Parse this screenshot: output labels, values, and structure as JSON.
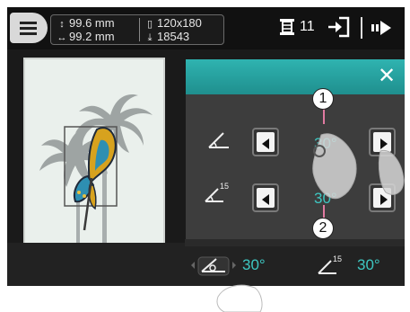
{
  "topbar": {
    "menu_icon": "hamburger-menu-icon",
    "height_value": "99.6 mm",
    "width_value": "99.2 mm",
    "hoop_size": "120x180",
    "stitch_count": "18543",
    "spool_count": "11",
    "enter_icon": "enter-arrow-icon",
    "next_icon": "next-arrow-icon"
  },
  "panel": {
    "close_icon": "close-icon",
    "row1": {
      "icon": "angle-icon",
      "value": "30°"
    },
    "row2": {
      "icon": "angle-15-icon",
      "icon_superscript": "15",
      "value": "30°"
    }
  },
  "bottom": {
    "item1": {
      "icon": "angle-eye-icon",
      "value": "30°"
    },
    "item2": {
      "icon": "angle-15-icon",
      "icon_superscript": "15",
      "value": "30°"
    }
  },
  "callouts": {
    "c1": "1",
    "c2": "2"
  },
  "colors": {
    "accent": "#3ec7c2",
    "header": "#2fb3b0",
    "panel": "#3d3d3d"
  }
}
